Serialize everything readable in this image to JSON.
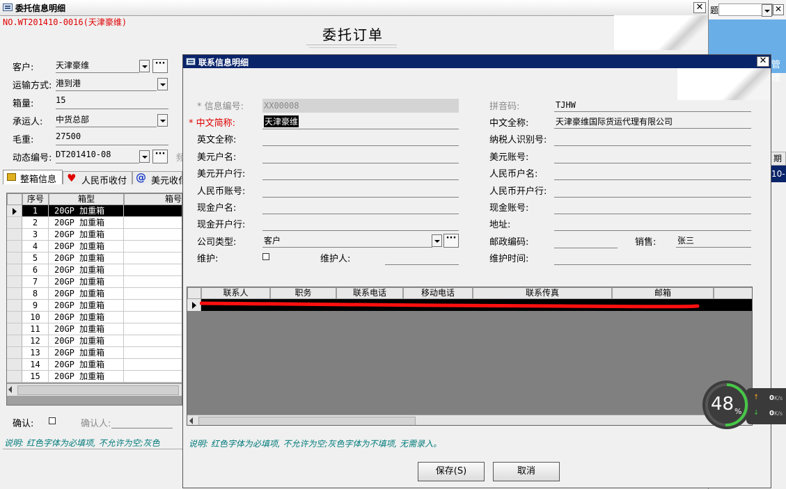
{
  "bg_window": {
    "title": "委托信息明细",
    "order_no": "NO.WT201410-0016(天津豪维)",
    "heading": "委托订单",
    "fields": [
      {
        "label": "客户:",
        "value": "天津豪维"
      },
      {
        "label": "运输方式:",
        "value": "港到港"
      },
      {
        "label": "箱量:",
        "value": "15"
      },
      {
        "label": "承运人:",
        "value": "中货总部"
      },
      {
        "label": "毛重:",
        "value": "27500"
      },
      {
        "label": "动态编号:",
        "value": "DT201410-08"
      }
    ],
    "truncated_char": "频",
    "tabs": [
      "整箱信息",
      "人民币收付",
      "美元收付"
    ],
    "grid_headers": [
      "序号",
      "箱型",
      "箱号"
    ],
    "grid_rows": [
      [
        "1",
        "20GP 加重箱"
      ],
      [
        "2",
        "20GP 加重箱"
      ],
      [
        "3",
        "20GP 加重箱"
      ],
      [
        "4",
        "20GP 加重箱"
      ],
      [
        "5",
        "20GP 加重箱"
      ],
      [
        "6",
        "20GP 加重箱"
      ],
      [
        "7",
        "20GP 加重箱"
      ],
      [
        "8",
        "20GP 加重箱"
      ],
      [
        "9",
        "20GP 加重箱"
      ],
      [
        "10",
        "20GP 加重箱"
      ],
      [
        "11",
        "20GP 加重箱"
      ],
      [
        "12",
        "20GP 加重箱"
      ],
      [
        "13",
        "20GP 加重箱"
      ],
      [
        "14",
        "20GP 加重箱"
      ],
      [
        "15",
        "20GP 加重箱"
      ]
    ],
    "confirm_label": "确认:",
    "confirmer_label": "确认人:",
    "note": "说明: 红色字体为必填项, 不允许为空;灰色"
  },
  "dialog": {
    "title": "联系信息明细",
    "left_fields": [
      {
        "label": "* 信息编号:",
        "value": "XX00008",
        "style": "gray"
      },
      {
        "label": "* 中文简称:",
        "value": "天津豪维",
        "style": "red"
      },
      {
        "label": "英文全称:",
        "value": ""
      },
      {
        "label": "美元户名:",
        "value": ""
      },
      {
        "label": "美元开户行:",
        "value": ""
      },
      {
        "label": "人民币账号:",
        "value": ""
      },
      {
        "label": "现金户名:",
        "value": ""
      },
      {
        "label": "现金开户行:",
        "value": ""
      },
      {
        "label": "公司类型:",
        "value": "客户"
      },
      {
        "label": "维护:",
        "value": ""
      }
    ],
    "maintainer_label": "维护人:",
    "right_fields": [
      {
        "label": "拼音码:",
        "value": "TJHW",
        "style": "gray"
      },
      {
        "label": "中文全称:",
        "value": "天津豪维国际货运代理有限公司"
      },
      {
        "label": "纳税人识别号:",
        "value": ""
      },
      {
        "label": "美元账号:",
        "value": ""
      },
      {
        "label": "人民币户名:",
        "value": ""
      },
      {
        "label": "人民币开户行:",
        "value": ""
      },
      {
        "label": "现金账号:",
        "value": ""
      },
      {
        "label": "地址:",
        "value": ""
      },
      {
        "label": "邮政编码:",
        "value": ""
      },
      {
        "label": "维护时间:",
        "value": ""
      }
    ],
    "sales_label": "销售:",
    "sales_value": "张三",
    "grid_headers": [
      "联系人",
      "职务",
      "联系电话",
      "移动电话",
      "联系传真",
      "邮箱"
    ],
    "note": "说明: 红色字体为必填项, 不允许为空;灰色字体为不填项, 无需录入。",
    "save_label": "保存(S)",
    "cancel_label": "取消"
  },
  "right_fragments": {
    "top_text": "题",
    "blue_text": "管理",
    "col_text": "期",
    "row_text": "10-"
  },
  "net_widget": {
    "percent": "48",
    "percent_unit": "%",
    "up": "0",
    "down": "0",
    "unit": "K/s"
  }
}
